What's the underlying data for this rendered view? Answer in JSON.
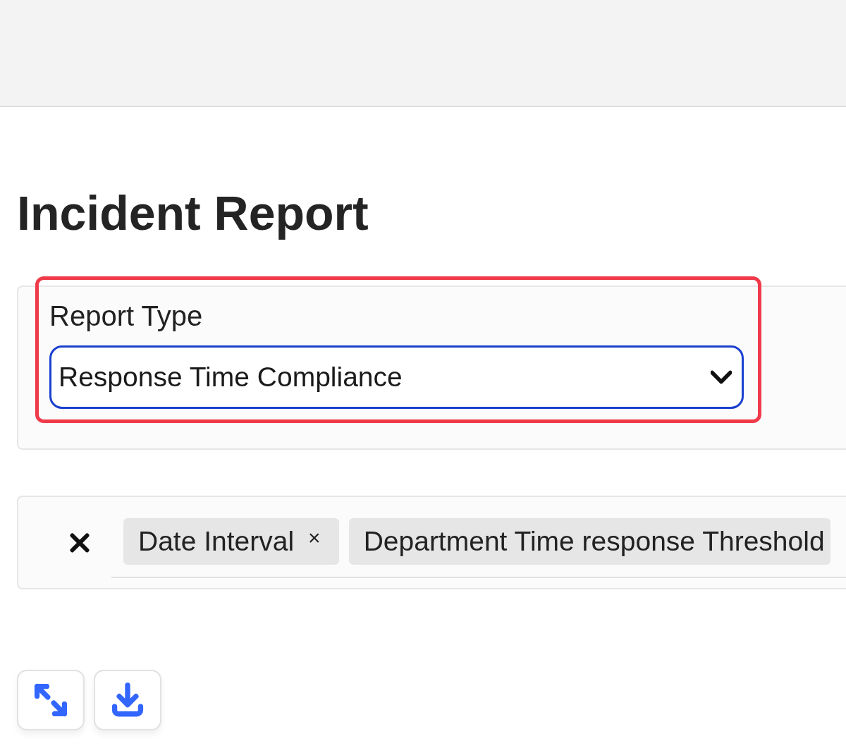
{
  "title": "Incident Report",
  "report_type": {
    "label": "Report Type",
    "value": "Response Time Compliance",
    "focused": true,
    "highlighted": true
  },
  "filters": {
    "chips": [
      {
        "label": "Date Interval",
        "remove": "×"
      },
      {
        "label": "Department Time response Threshold"
      }
    ]
  },
  "actions": [
    {
      "kind": "expand"
    },
    {
      "kind": "download"
    }
  ]
}
